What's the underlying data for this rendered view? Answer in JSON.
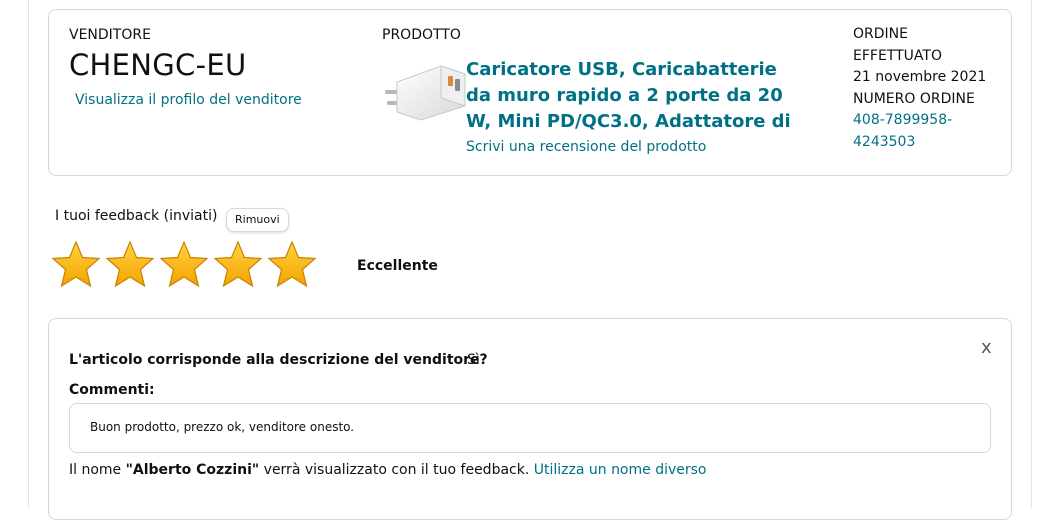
{
  "seller": {
    "label": "VENDITORE",
    "name": "CHENGC-EU",
    "profile_link": "Visualizza il profilo del venditore"
  },
  "product": {
    "label": "PRODOTTO",
    "title": "Caricatore USB, Caricabatterie da muro rapido a 2 porte da 20 W, Mini PD/QC3.0, Adattatore di ali…",
    "review_link": "Scrivi una recensione del prodotto",
    "image_icon": "usb-charger-image"
  },
  "order": {
    "placed_label": "ORDINE EFFETTUATO",
    "date": "21 novembre 2021",
    "number_label": "NUMERO ORDINE",
    "number": "408-7899958-4243503"
  },
  "feedback": {
    "title": "I tuoi feedback (inviati)",
    "remove_label": "Rimuovi",
    "rating": 5,
    "rating_max": 5,
    "rating_label": "Eccellente",
    "star_color": "#FFB800"
  },
  "details": {
    "close_label": "x",
    "question": "L'articolo corrisponde alla descrizione del venditore?",
    "answer": "Sì",
    "comments_label": "Commenti:",
    "comment": "Buon prodotto, prezzo ok, venditore onesto.",
    "name_prefix": "Il nome ",
    "name": "\"Alberto Cozzini\"",
    "name_suffix": " verrà visualizzato con il tuo feedback. ",
    "change_name_link": "Utilizza un nome diverso"
  },
  "colors": {
    "link": "#007185",
    "border": "#D5D9D9",
    "text": "#0F1111"
  }
}
